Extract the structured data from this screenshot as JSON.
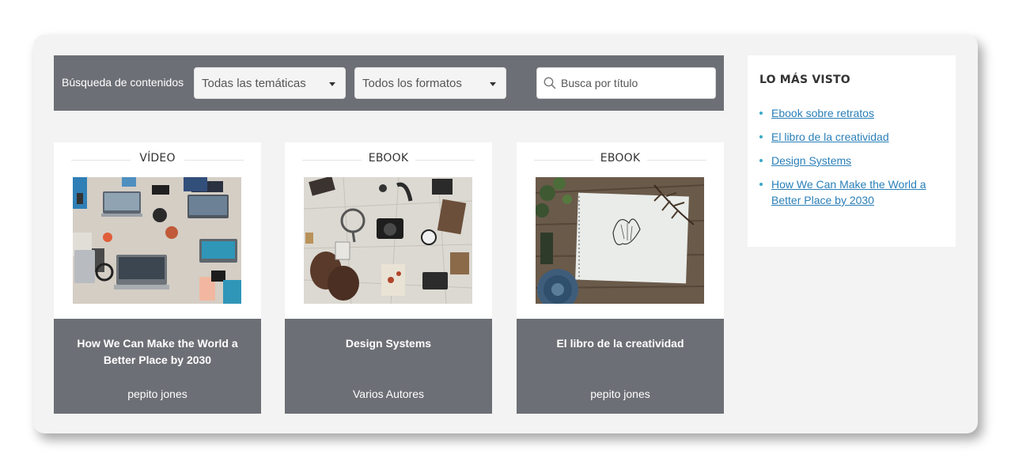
{
  "search": {
    "label": "Búsqueda de contenidos",
    "topic_select": "Todas las temáticas",
    "format_select": "Todos los formatos",
    "title_placeholder": "Busca por título"
  },
  "cards": [
    {
      "type": "VÍDEO",
      "title": "How We Can Make the World a Better Place by 2030",
      "author": "pepito jones",
      "image": "laptops-desk-photo"
    },
    {
      "type": "EBOOK",
      "title": "Design Systems",
      "author": "Varios Autores",
      "image": "vintage-camera-flatlay-photo"
    },
    {
      "type": "EBOOK",
      "title": "El libro de la creatividad",
      "author": "pepito jones",
      "image": "butterfly-sketchbook-photo"
    }
  ],
  "sidebar": {
    "heading": "LO MÁS VISTO",
    "links": [
      "Ebook sobre retratos",
      "El libro de la creatividad",
      "Design Systems",
      "How We Can Make the World a Better Place by 2030"
    ]
  },
  "colors": {
    "bar": "#6d6f76",
    "panel": "#f2f3f2",
    "link": "#2a7fb8",
    "bullet": "#3aa9c6"
  }
}
